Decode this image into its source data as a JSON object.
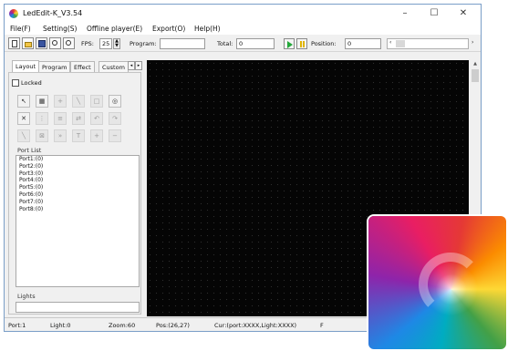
{
  "app": {
    "title": "LedEdit-K_V3.54",
    "window_controls": {
      "minimize": "–",
      "maximize": "☐",
      "close": "✕"
    }
  },
  "menu": {
    "items": [
      "File(F)",
      "Setting(S)",
      "Offline player(E)",
      "Export(O)",
      "Help(H)"
    ]
  },
  "toolbar": {
    "fps_label": "FPS:",
    "fps_value": "25",
    "program_label": "Program:",
    "program_value": "",
    "total_label": "Total:",
    "total_value": "0",
    "position_label": "Position:",
    "position_value": "0",
    "icons": [
      "new-icon",
      "open-icon",
      "save-icon",
      "zoom-in-icon",
      "zoom-out-icon",
      "play-icon",
      "pause-icon"
    ]
  },
  "left_panel": {
    "tabs": [
      "Layout",
      "Program",
      "Effect",
      "Custom"
    ],
    "locked_label": "Locked",
    "locked_checked": false,
    "port_list_label": "Port List",
    "ports": [
      "Port1:(0)",
      "Port2:(0)",
      "Port3:(0)",
      "Port4:(0)",
      "Port5:(0)",
      "Port6:(0)",
      "Port7:(0)",
      "Port8:(0)"
    ],
    "lights_label": "Lights"
  },
  "status_bar": {
    "port": "Port:1",
    "light": "Light:0",
    "zoom": "Zoom:60",
    "pos": "Pos:(26,27)",
    "cur": "Cur:(port:XXXX,Light:XXXX)",
    "extra": "F"
  },
  "colors": {
    "canvas_bg": "#050505",
    "grid_dot": "#2e2e2e",
    "play_green": "#24a83a",
    "pause_yellow": "#e0b400"
  }
}
